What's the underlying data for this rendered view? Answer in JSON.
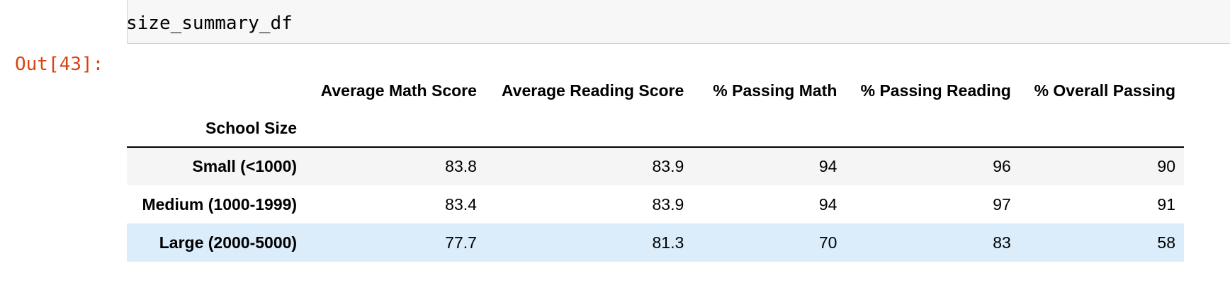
{
  "input_cell": {
    "code": "size_summary_df"
  },
  "output_cell": {
    "prompt": "Out[43]:"
  },
  "dataframe": {
    "index_name": "School Size",
    "columns": [
      "Average Math Score",
      "Average Reading Score",
      "% Passing Math",
      "% Passing Reading",
      "% Overall Passing"
    ],
    "rows": [
      {
        "index": "Small (<1000)",
        "values": [
          "83.8",
          "83.9",
          "94",
          "96",
          "90"
        ]
      },
      {
        "index": "Medium (1000-1999)",
        "values": [
          "83.4",
          "83.9",
          "94",
          "97",
          "91"
        ]
      },
      {
        "index": "Large (2000-5000)",
        "values": [
          "77.7",
          "81.3",
          "70",
          "83",
          "58"
        ]
      }
    ]
  },
  "colors": {
    "prompt_out": "#d84315",
    "input_background": "#f7f7f7",
    "striped_row": "#f5f5f5",
    "hover_row": "#dbecfa"
  }
}
